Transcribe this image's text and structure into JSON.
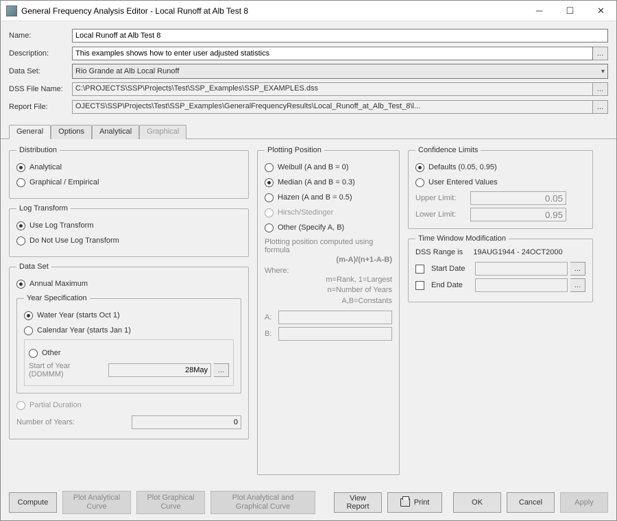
{
  "window": {
    "title": "General Frequency Analysis Editor - Local Runoff at Alb Test 8"
  },
  "form": {
    "name_label": "Name:",
    "name_value": "Local Runoff at Alb Test 8",
    "desc_label": "Description:",
    "desc_value": "This examples shows how to enter user adjusted statistics",
    "dataset_label": "Data Set:",
    "dataset_value": "Rio Grande at Alb Local Runoff",
    "dss_label": "DSS File Name:",
    "dss_value": "C:\\PROJECTS\\SSP\\Projects\\Test\\SSP_Examples\\SSP_EXAMPLES.dss",
    "report_label": "Report File:",
    "report_value": "OJECTS\\SSP\\Projects\\Test\\SSP_Examples\\GeneralFrequencyResults\\Local_Runoff_at_Alb_Test_8\\l..."
  },
  "tabs": {
    "general": "General",
    "options": "Options",
    "analytical": "Analytical",
    "graphical": "Graphical"
  },
  "distribution": {
    "legend": "Distribution",
    "analytical": "Analytical",
    "graphical": "Graphical / Empirical"
  },
  "logtransform": {
    "legend": "Log Transform",
    "use": "Use Log Transform",
    "dont": "Do Not Use Log Transform"
  },
  "dataset": {
    "legend": "Data Set",
    "annual": "Annual Maximum",
    "yearspec": {
      "legend": "Year Specification",
      "water": "Water Year (starts Oct 1)",
      "calendar": "Calendar Year (starts Jan 1)",
      "other": "Other",
      "start_label": "Start of Year (DDMMM)",
      "start_value": "28May"
    },
    "partial": "Partial Duration",
    "numyears_label": "Number of Years:",
    "numyears_value": "0"
  },
  "plotting": {
    "legend": "Plotting Position",
    "weibull": "Weibull (A and B = 0)",
    "median": "Median (A and B = 0.3)",
    "hazen": "Hazen (A and B = 0.5)",
    "hirsch": "Hirsch/Stedinger",
    "other": "Other (Specify A, B)",
    "computed_text": "Plotting position computed using formula",
    "formula": "(m-A)/(n+1-A-B)",
    "where": "Where:",
    "where1": "m=Rank, 1=Largest",
    "where2": "n=Number of Years",
    "where3": "A,B=Constants",
    "a_label": "A:",
    "b_label": "B:"
  },
  "confidence": {
    "legend": "Confidence Limits",
    "defaults": "Defaults (0.05, 0.95)",
    "user": "User Entered Values",
    "upper_label": "Upper Limit:",
    "upper_value": "0.05",
    "lower_label": "Lower Limit:",
    "lower_value": "0.95"
  },
  "timewindow": {
    "legend": "Time Window Modification",
    "range_label": "DSS Range is",
    "range_value": "19AUG1944 - 24OCT2000",
    "start": "Start Date",
    "end": "End Date"
  },
  "footer": {
    "compute": "Compute",
    "plot_analytical": "Plot Analytical Curve",
    "plot_graphical": "Plot Graphical Curve",
    "plot_both": "Plot Analytical and Graphical Curve",
    "view_report": "View Report",
    "print": "Print",
    "ok": "OK",
    "cancel": "Cancel",
    "apply": "Apply"
  }
}
